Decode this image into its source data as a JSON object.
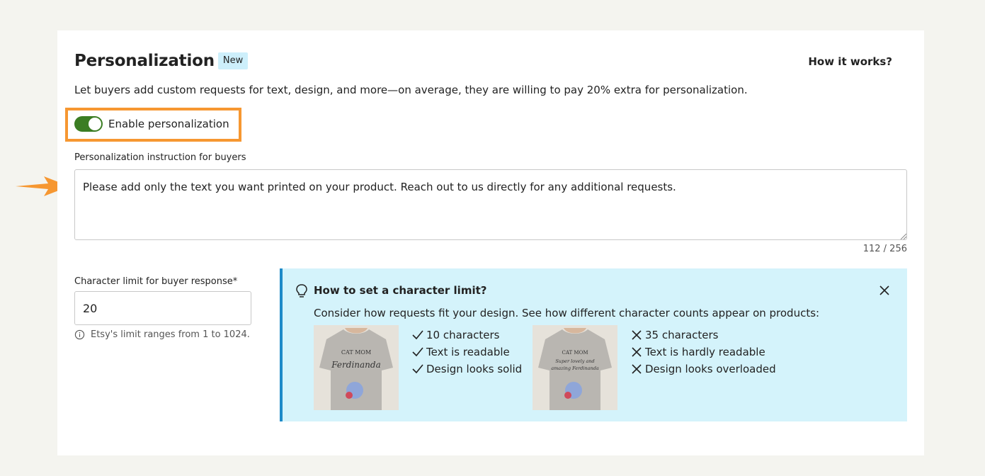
{
  "section": {
    "title": "Personalization",
    "badge": "New",
    "how_link": "How it works?",
    "description": "Let buyers add custom requests for text, design, and more—on average, they are willing to pay 20% extra for personalization."
  },
  "toggle": {
    "label": "Enable personalization",
    "enabled": true
  },
  "instruction": {
    "label": "Personalization instruction for buyers",
    "value": "Please add only the text you want printed on your product. Reach out to us directly for any additional requests.",
    "counter": "112 / 256"
  },
  "limit": {
    "label": "Character limit for buyer response",
    "required_mark": "*",
    "value": "20",
    "hint": "Etsy's limit ranges from 1 to 1024."
  },
  "tip": {
    "title": "How to set a character limit?",
    "text": "Consider how requests fit your design. See how different character counts appear on products:",
    "good": {
      "shirt_line1": "CAT MOM",
      "shirt_line2": "Ferdinanda",
      "items": [
        "10 characters",
        "Text is readable",
        "Design looks solid"
      ]
    },
    "bad": {
      "shirt_line1": "CAT MOM",
      "shirt_line2": "Super lovely and",
      "shirt_line3": "amazing Ferdinanda",
      "items": [
        "35 characters",
        "Text is hardly readable",
        "Design looks overloaded"
      ]
    }
  },
  "colors": {
    "toggle_on": "#3b7d23",
    "highlight": "#f69731",
    "tip_bg": "#d4f3fb",
    "tip_border": "#1e8ac8",
    "badge_bg": "#cdeffb"
  }
}
